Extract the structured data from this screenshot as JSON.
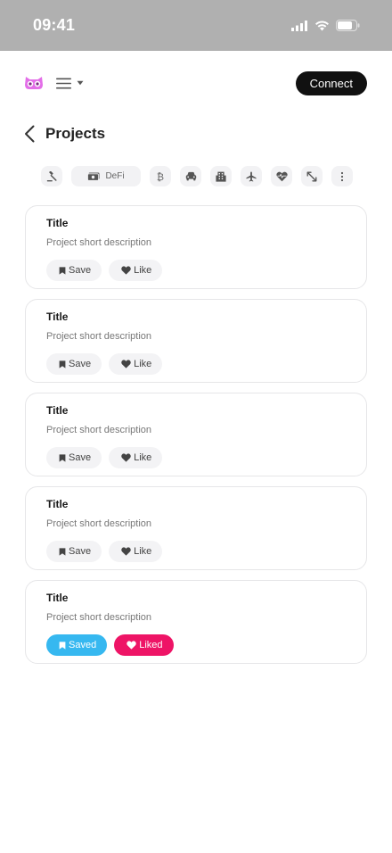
{
  "status": {
    "time": "09:41"
  },
  "header": {
    "connect_label": "Connect"
  },
  "page": {
    "title": "Projects"
  },
  "filters": {
    "items": [
      {
        "icon": "gavel-icon"
      },
      {
        "icon": "money-icon",
        "label": "DeFi"
      },
      {
        "icon": "bitcoin-icon"
      },
      {
        "icon": "car-icon"
      },
      {
        "icon": "building-icon"
      },
      {
        "icon": "airplane-icon"
      },
      {
        "icon": "heart-pulse-icon"
      },
      {
        "icon": "expand-icon"
      },
      {
        "icon": "more-icon"
      }
    ]
  },
  "projects": [
    {
      "title": "Title",
      "description": "Project short description",
      "save_label": "Save",
      "like_label": "Like",
      "saved": false,
      "liked": false
    },
    {
      "title": "Title",
      "description": "Project short description",
      "save_label": "Save",
      "like_label": "Like",
      "saved": false,
      "liked": false
    },
    {
      "title": "Title",
      "description": "Project short description",
      "save_label": "Save",
      "like_label": "Like",
      "saved": false,
      "liked": false
    },
    {
      "title": "Title",
      "description": "Project short description",
      "save_label": "Save",
      "like_label": "Like",
      "saved": false,
      "liked": false
    },
    {
      "title": "Title",
      "description": "Project short description",
      "save_label": "Saved",
      "like_label": "Liked",
      "saved": true,
      "liked": true
    }
  ],
  "colors": {
    "saved": "#36b8f0",
    "liked": "#ee1466",
    "logo": "#e36ee8",
    "connect": "#111111"
  }
}
